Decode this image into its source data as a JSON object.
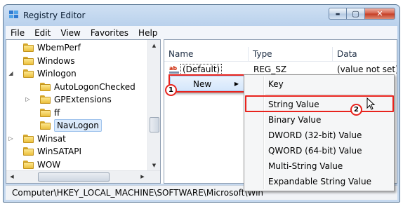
{
  "window": {
    "title": "Registry Editor"
  },
  "window_buttons": {
    "minimize": "▬",
    "maximize": "▢",
    "close": "✕"
  },
  "menubar": [
    "File",
    "Edit",
    "View",
    "Favorites",
    "Help"
  ],
  "tree": [
    {
      "label": "WbemPerf",
      "indent": 1,
      "expander": ""
    },
    {
      "label": "Windows",
      "indent": 1,
      "expander": ""
    },
    {
      "label": "Winlogon",
      "indent": 1,
      "expander": "◢"
    },
    {
      "label": "AutoLogonChecked",
      "indent": 2,
      "expander": ""
    },
    {
      "label": "GPExtensions",
      "indent": 2,
      "expander": "▷"
    },
    {
      "label": "ff",
      "indent": 2,
      "expander": ""
    },
    {
      "label": "NavLogon",
      "indent": 2,
      "expander": "",
      "selected": true
    },
    {
      "label": "Winsat",
      "indent": 1,
      "expander": "▷"
    },
    {
      "label": "WinSATAPI",
      "indent": 1,
      "expander": ""
    },
    {
      "label": "WOW",
      "indent": 1,
      "expander": ""
    }
  ],
  "list": {
    "columns": [
      "Name",
      "Type",
      "Data"
    ],
    "rows": [
      {
        "name": "(Default)",
        "type": "REG_SZ",
        "data": "(value not set)",
        "icon": "ab-string-icon"
      }
    ]
  },
  "context_menu": {
    "items": [
      "New"
    ]
  },
  "submenu": {
    "items": [
      "Key",
      "String Value",
      "Binary Value",
      "DWORD (32-bit) Value",
      "QWORD (64-bit) Value",
      "Multi-String Value",
      "Expandable String Value"
    ]
  },
  "steps": [
    "1",
    "2"
  ],
  "statusbar": {
    "path": "Computer\\HKEY_LOCAL_MACHINE\\SOFTWARE\\Microsoft\\Win"
  },
  "colors": {
    "highlight": "#e8231d",
    "titlebar": "#b9d1ec"
  }
}
